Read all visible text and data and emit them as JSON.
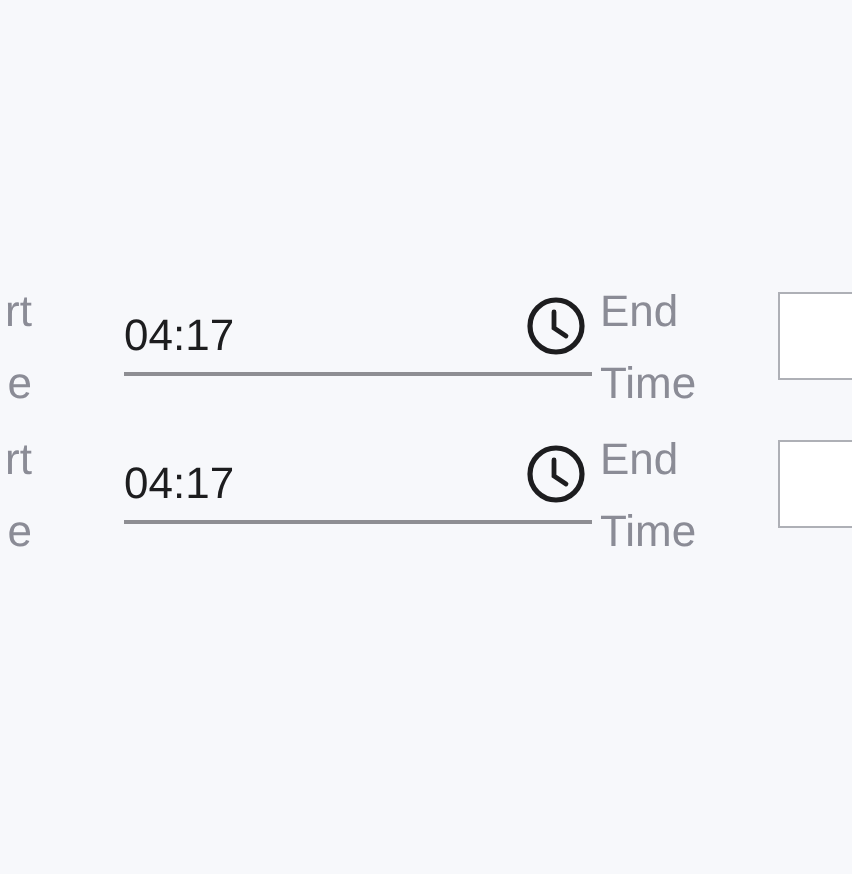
{
  "rows": [
    {
      "start_label": "rt e",
      "start_time": "04:17",
      "end_label": "End Time"
    },
    {
      "start_label": "rt e",
      "start_time": "04:17",
      "end_label": "End Time"
    }
  ]
}
